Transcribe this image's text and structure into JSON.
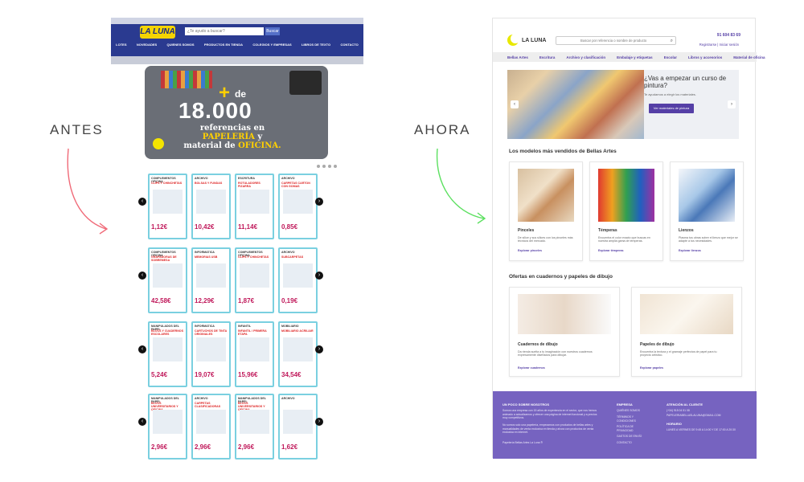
{
  "labels": {
    "before": "ANTES",
    "after": "AHORA"
  },
  "colors": {
    "old_nav": "#2a3a90",
    "brand_purple": "#553fa6",
    "footer": "#7663c0",
    "accent_red": "#c0185a"
  },
  "old": {
    "logo": "LA LUNA",
    "search_placeholder": "¿Te ayudo a buscar?",
    "search_btn": "Buscar",
    "nav": [
      "LOTES",
      "NOVEDADES",
      "QUIENES SOMOS",
      "PRODUCTOS EN TIENDA",
      "COLEGIOS Y EMPRESAS",
      "LIBROS DE TEXTO",
      "CONTACTO"
    ],
    "hero": {
      "plus": "+",
      "number": "18.000",
      "de": "de",
      "line1": "referencias en",
      "line2": "PAPELERÍA",
      "line3": "y",
      "line4": "material de",
      "line5": "OFICINA."
    },
    "rows": [
      [
        {
          "cat": "COMPLEMENTOS OFICINA",
          "name": "CLIPS Y CHINCHETAS",
          "price": "1,12€"
        },
        {
          "cat": "ARCHIVO",
          "name": "BOLSAS Y FUNDAS",
          "price": "10,42€"
        },
        {
          "cat": "ESCRITURA",
          "name": "ROTULADORES PIZARRA",
          "price": "11,14€"
        },
        {
          "cat": "ARCHIVO",
          "name": "CARPETAS CARTON CON GOMAS",
          "price": "0,85€"
        }
      ],
      [
        {
          "cat": "COMPLEMENTOS OFICINA",
          "name": "GRAPADORAS DE SOBREMESA",
          "price": "42,58€"
        },
        {
          "cat": "INFORMATICA",
          "name": "MEMORIAS USB",
          "price": "12,29€"
        },
        {
          "cat": "COMPLEMENTOS OFICINA",
          "name": "CLIPS Y CHINCHETAS",
          "price": "1,87€"
        },
        {
          "cat": "ARCHIVO",
          "name": "SUBCARPETAS",
          "price": "0,19€"
        }
      ],
      [
        {
          "cat": "MANIPULADOS DEL PAPEL",
          "name": "BLOCS Y CUADERNOS ESCOLARES",
          "price": "5,24€"
        },
        {
          "cat": "INFORMATICA",
          "name": "CARTUCHOS DE TINTA ORIGINALES",
          "price": "19,07€"
        },
        {
          "cat": "INFANTIL",
          "name": "INFANTIL / PRIMERA ETAPA",
          "price": "15,96€"
        },
        {
          "cat": "MOBILIARIO",
          "name": "MOBILIARIO ACRILIAR",
          "price": "34,54€"
        }
      ],
      [
        {
          "cat": "MANIPULADOS DEL PAPEL",
          "name": "BLOCS UNIVERSITARIOS Y OFICINA",
          "price": "2,96€"
        },
        {
          "cat": "ARCHIVO",
          "name": "CARPETAS CLASIFICADORAS",
          "price": "2,96€"
        },
        {
          "cat": "MANIPULADOS DEL PAPEL",
          "name": "BLOCS UNIVERSITARIOS Y OFICINA",
          "price": "2,96€"
        },
        {
          "cat": "ARCHIVO",
          "name": "",
          "price": "1,62€"
        }
      ]
    ]
  },
  "new": {
    "logo": "LA LUNA",
    "search_placeholder": "Buscar por referencia o nombre de producto",
    "phone": "91 604 83 69",
    "account": "Registrarse | Iniciar sesión",
    "menu": [
      "Bellas Artes",
      "Escritura",
      "Archivo y clasificación",
      "Embalaje y etiquetas",
      "Escolar",
      "Libros y accesorios",
      "Material de oficina"
    ],
    "hero": {
      "title": "¿Vas a empezar un curso de pintura?",
      "subtitle": "Te ayudamos a elegir los materiales.",
      "button": "Ver materiales de pintura"
    },
    "section1": "Los modelos más vendidos de Bellas Artes",
    "cards1": [
      {
        "title": "Pinceles",
        "desc": "De sílice y sus sílices con los pinceles más técnicos del mercado.",
        "link": "Explorar pinceles"
      },
      {
        "title": "Témperas",
        "desc": "Encuentra el color exacto que buscas en nuestra amplia gama de témperas.",
        "link": "Explorar témperas"
      },
      {
        "title": "Lienzos",
        "desc": "Plasma tus obras sobre el lienzo que mejor se adapte a tus necesidades.",
        "link": "Explorar lienzos"
      }
    ],
    "section2": "Ofertas en cuadernos y papeles de dibujo",
    "cards2": [
      {
        "title": "Cuadernos de dibujo",
        "desc": "Da rienda suelta a tu imaginación con nuestros cuadernos expresamente diseñados para dibujar.",
        "link": "Explorar cuadernos"
      },
      {
        "title": "Papeles de dibujo",
        "desc": "Encuentra la textura y el gramaje perfectos de papel para tu proyecto artístico.",
        "link": "Explorar papeles"
      }
    ],
    "footer": {
      "about_h": "UN POCO SOBRE NOSOTROS",
      "about_p": "Somos una empresa con 15 años de experiencia en el sector, que nos hemos animado a actualizarnos y ofrecer una página de internet funcional y a precios muy competitivos.",
      "about_p2": "No somos solo una papelería, empezamos con productos de bellas artes y manualidades de venta exclusiva en tienda y ahora con productos de venta exclusiva en internet.",
      "about_p3": "Papelería Bellas Artes La Luna ®",
      "company_h": "EMPRESA",
      "company": [
        "QUIÉNES SOMOS",
        "TÉRMINOS Y CONDICIONES",
        "POLÍTICA DE PRIVACIDAD",
        "GASTOS DE ENVÍO",
        "CONTACTO"
      ],
      "contact_h": "ATENCIÓN AL CLIENTE",
      "contact": "(+34) 915 04 51 08",
      "email": "PAPELERIABELLASLALUNA@GMAIL.COM",
      "hours_h": "HORARIO",
      "hours": "LUNES A VIERNES DE 9:45 A 14:00 Y DE 17:00 A 20:30"
    }
  }
}
